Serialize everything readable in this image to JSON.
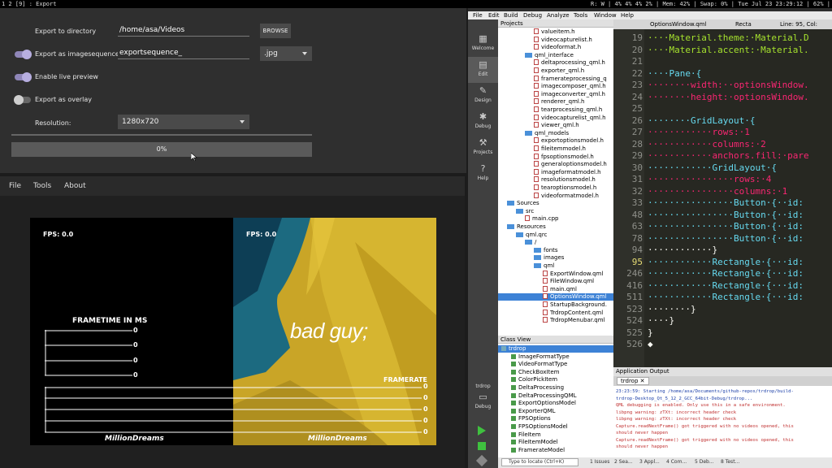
{
  "topbar": {
    "left": "1 2 [9] : Export",
    "right": "R: W | 4% 4% 4% 2% | Mem: 42% | Swap: 0% | Tue Jul 23 23:29:12 | 62% |"
  },
  "export_window": {
    "dir_label": "Export to directory",
    "dir_value": "/home/asa/Videos",
    "browse": "BROWSE",
    "seq_label": "Export as imagesequence",
    "seq_value": "exportsequence_",
    "format": ".jpg",
    "live_label": "Enable live preview",
    "overlay_label": "Export as overlay",
    "res_label": "Resolution:",
    "res_value": "1280x720",
    "progress_text": "0%",
    "progress_value": 0,
    "toggles": {
      "seq": true,
      "live": true,
      "overlay": false
    }
  },
  "preview": {
    "menu": [
      "File",
      "Tools",
      "About"
    ],
    "fps_left": "FPS: 0.0",
    "fps_right": "FPS: 0.0",
    "frametime_label": "FRAMETIME IN MS",
    "framerate_label": "FRAMERATE",
    "frametime_ticks": [
      "0",
      "0",
      "0",
      "0"
    ],
    "framerate_ticks": [
      "0",
      "0",
      "0",
      "0",
      "0"
    ],
    "watermark": "MillionDreams",
    "overlay_text": "bad guy;"
  },
  "qt": {
    "menu": [
      "File",
      "Edit",
      "Build",
      "Debug",
      "Analyze",
      "Tools",
      "Window",
      "Help"
    ],
    "modes": [
      "Welcome",
      "Edit",
      "Design",
      "Debug",
      "Projects",
      "Help"
    ],
    "lower_modes": [
      "trdrop",
      "Debug"
    ],
    "projects_title": "Projects",
    "tree": [
      {
        "t": "valueitem.h",
        "d": 4,
        "k": "f"
      },
      {
        "t": "videocapturelist.h",
        "d": 4,
        "k": "f"
      },
      {
        "t": "videoformat.h",
        "d": 4,
        "k": "f"
      },
      {
        "t": "qml_interface",
        "d": 3,
        "k": "d"
      },
      {
        "t": "deltaprocessing_qml.h",
        "d": 4,
        "k": "f"
      },
      {
        "t": "exporter_qml.h",
        "d": 4,
        "k": "f"
      },
      {
        "t": "framerateprocessing_q",
        "d": 4,
        "k": "f"
      },
      {
        "t": "imagecomposer_qml.h",
        "d": 4,
        "k": "f"
      },
      {
        "t": "imageconverter_qml.h",
        "d": 4,
        "k": "f"
      },
      {
        "t": "renderer_qml.h",
        "d": 4,
        "k": "f"
      },
      {
        "t": "tearprocessing_qml.h",
        "d": 4,
        "k": "f"
      },
      {
        "t": "videocapturelist_qml.h",
        "d": 4,
        "k": "f"
      },
      {
        "t": "viewer_qml.h",
        "d": 4,
        "k": "f"
      },
      {
        "t": "qml_models",
        "d": 3,
        "k": "d"
      },
      {
        "t": "exportoptionsmodel.h",
        "d": 4,
        "k": "f"
      },
      {
        "t": "fileitemmodel.h",
        "d": 4,
        "k": "f"
      },
      {
        "t": "fpsoptionsmodel.h",
        "d": 4,
        "k": "f"
      },
      {
        "t": "generaloptionsmodel.h",
        "d": 4,
        "k": "f"
      },
      {
        "t": "imageformatmodel.h",
        "d": 4,
        "k": "f"
      },
      {
        "t": "resolutionsmodel.h",
        "d": 4,
        "k": "f"
      },
      {
        "t": "tearoptionsmodel.h",
        "d": 4,
        "k": "f"
      },
      {
        "t": "videoformatmodel.h",
        "d": 4,
        "k": "f"
      },
      {
        "t": "Sources",
        "d": 1,
        "k": "d"
      },
      {
        "t": "src",
        "d": 2,
        "k": "d"
      },
      {
        "t": "main.cpp",
        "d": 3,
        "k": "f"
      },
      {
        "t": "Resources",
        "d": 1,
        "k": "d"
      },
      {
        "t": "qml.qrc",
        "d": 2,
        "k": "d"
      },
      {
        "t": "/",
        "d": 3,
        "k": "d"
      },
      {
        "t": "fonts",
        "d": 4,
        "k": "d"
      },
      {
        "t": "images",
        "d": 4,
        "k": "d"
      },
      {
        "t": "qml",
        "d": 4,
        "k": "d"
      },
      {
        "t": "ExportWindow.qml",
        "d": 5,
        "k": "f"
      },
      {
        "t": "FileWindow.qml",
        "d": 5,
        "k": "f"
      },
      {
        "t": "main.qml",
        "d": 5,
        "k": "f"
      },
      {
        "t": "OptionsWindow.qml",
        "d": 5,
        "k": "f",
        "sel": true
      },
      {
        "t": "StartupBackground.",
        "d": 5,
        "k": "f"
      },
      {
        "t": "TrdropContent.qml",
        "d": 5,
        "k": "f"
      },
      {
        "t": "TrdropMenubar.qml",
        "d": 5,
        "k": "f"
      }
    ],
    "classview_title": "Class View",
    "classview": [
      "trdrop",
      "ImageFormatType",
      "VideoFormatType",
      "CheckBoxItem",
      "ColorPickItem",
      "DeltaProcessing",
      "DeltaProcessingQML",
      "ExportOptionsModel",
      "ExporterQML",
      "FPSOptions",
      "FPSOptionsModel",
      "FileItem",
      "FileItemModel",
      "FramerateModel"
    ],
    "editor_tab": "OptionsWindow.qml",
    "editor_info": "Recta",
    "editor_pos": "Line: 95, Col:",
    "lines": [
      {
        "n": "19",
        "c": "····Material.theme:·Material.D"
      },
      {
        "n": "20",
        "c": "····Material.accent:·Material."
      },
      {
        "n": "21",
        "c": ""
      },
      {
        "n": "22",
        "c": "····Pane·{"
      },
      {
        "n": "23",
        "c": "········width:··optionsWindow."
      },
      {
        "n": "24",
        "c": "········height:·optionsWindow."
      },
      {
        "n": "25",
        "c": ""
      },
      {
        "n": "26",
        "c": "········GridLayout·{"
      },
      {
        "n": "27",
        "c": "············rows:·1"
      },
      {
        "n": "28",
        "c": "············columns:·2"
      },
      {
        "n": "29",
        "c": "············anchors.fill:·pare"
      },
      {
        "n": "30",
        "c": "············GridLayout·{"
      },
      {
        "n": "31",
        "c": "················rows:·4"
      },
      {
        "n": "32",
        "c": "················columns:·1"
      },
      {
        "n": "33",
        "c": "················Button·{··id:"
      },
      {
        "n": "48",
        "c": "················Button·{··id:"
      },
      {
        "n": "63",
        "c": "················Button·{··id:"
      },
      {
        "n": "78",
        "c": "················Button·{··id:"
      },
      {
        "n": "94",
        "c": "············}"
      },
      {
        "n": "95",
        "c": "············Rectangle·{···id:"
      },
      {
        "n": "246",
        "c": "············Rectangle·{···id:"
      },
      {
        "n": "416",
        "c": "············Rectangle·{···id:"
      },
      {
        "n": "511",
        "c": "············Rectangle·{···id:"
      },
      {
        "n": "523",
        "c": "········}"
      },
      {
        "n": "524",
        "c": "····}"
      },
      {
        "n": "525",
        "c": "}"
      },
      {
        "n": "526",
        "c": "◆"
      }
    ],
    "app_output_title": "Application Output",
    "app_tab": "trdrop",
    "log": [
      {
        "c": "#1b3fa8",
        "t": "23:23:59: Starting /home/asa/Documents/github-repos/trdrop/build-"
      },
      {
        "c": "#1b3fa8",
        "t": "trdrop-Desktop_Qt_5_12_2_GCC_64bit-Debug/trdrop..."
      },
      {
        "c": "#c03030",
        "t": "QML debugging is enabled. Only use this in a safe environment."
      },
      {
        "c": "#c03030",
        "t": "libpng warning: zTXt: incorrect header check"
      },
      {
        "c": "#c03030",
        "t": "libpng warning: zTXt: incorrect header check"
      },
      {
        "c": "#c03030",
        "t": "Capture.readNextFrame() got triggered with no videos opened, this"
      },
      {
        "c": "#c03030",
        "t": "should never happen"
      },
      {
        "c": "#c03030",
        "t": "Capture.readNextFrame() got triggered with no videos opened, this"
      },
      {
        "c": "#c03030",
        "t": "should never happen"
      }
    ],
    "locator_placeholder": "Type to locate (Ctrl+K)",
    "bottom_tabs": [
      "1 Issues",
      "2 Sea...",
      "3 Appl...",
      "4 Com...",
      "5 Deb...",
      "8 Test..."
    ]
  }
}
